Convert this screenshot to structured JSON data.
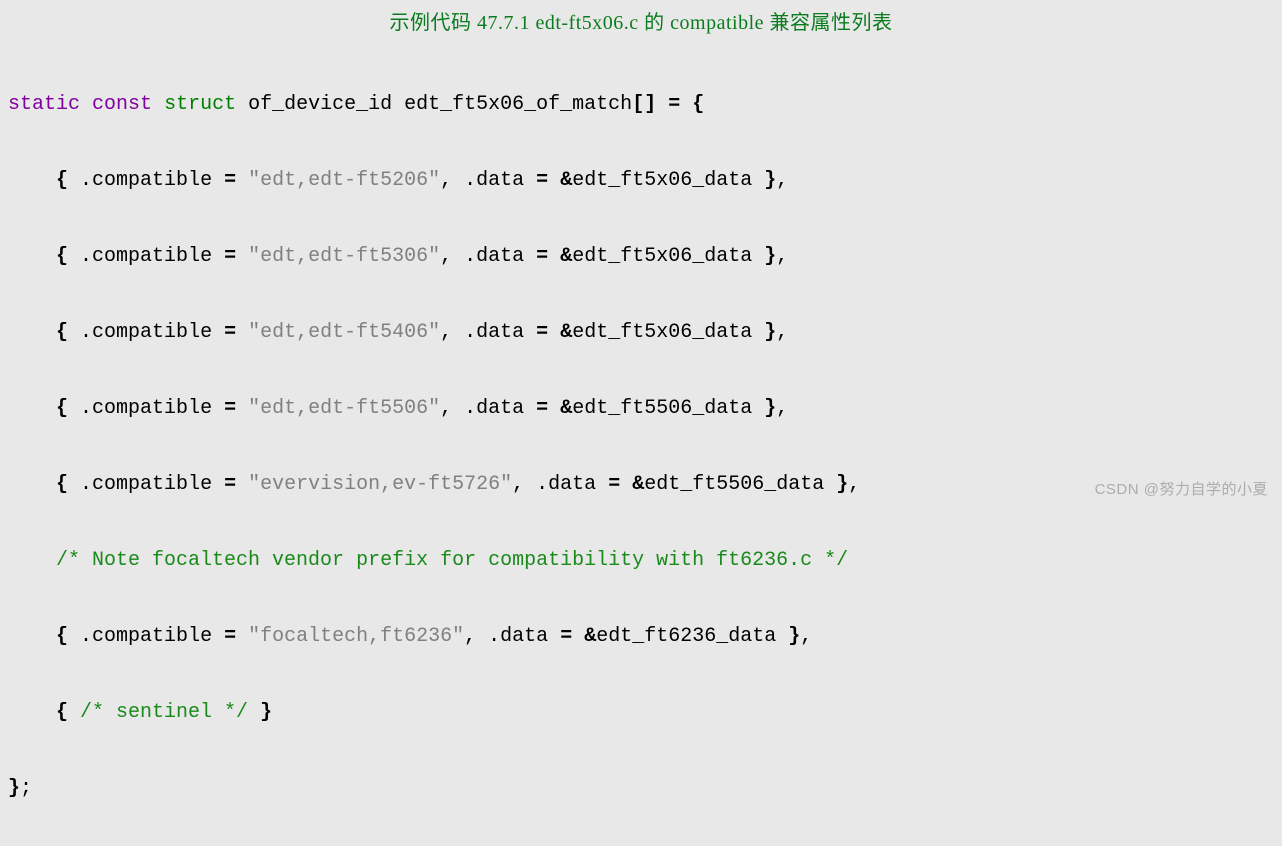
{
  "title": "示例代码 47.7.1 edt-ft5x06.c 的 compatible 兼容属性列表",
  "line1": {
    "kw1": "static",
    "kw2": "const",
    "kw3": "struct",
    "type": "of_device_id",
    "var": "edt_ft5x06_of_match",
    "brackets": "[]",
    "eq": " = ",
    "brace": "{"
  },
  "entries": [
    {
      "lb": "{ ",
      "dot1": ".",
      "field1": "compatible",
      "eq1": " = ",
      "str": "\"edt,edt-ft5206\"",
      "comma1": ", ",
      "dot2": ".",
      "field2": "data",
      "eq2": " = ",
      "amp": "&",
      "dataval": "edt_ft5x06_data",
      "rb": " }",
      "tc": ","
    },
    {
      "lb": "{ ",
      "dot1": ".",
      "field1": "compatible",
      "eq1": " = ",
      "str": "\"edt,edt-ft5306\"",
      "comma1": ", ",
      "dot2": ".",
      "field2": "data",
      "eq2": " = ",
      "amp": "&",
      "dataval": "edt_ft5x06_data",
      "rb": " }",
      "tc": ","
    },
    {
      "lb": "{ ",
      "dot1": ".",
      "field1": "compatible",
      "eq1": " = ",
      "str": "\"edt,edt-ft5406\"",
      "comma1": ", ",
      "dot2": ".",
      "field2": "data",
      "eq2": " = ",
      "amp": "&",
      "dataval": "edt_ft5x06_data",
      "rb": " }",
      "tc": ","
    },
    {
      "lb": "{ ",
      "dot1": ".",
      "field1": "compatible",
      "eq1": " = ",
      "str": "\"edt,edt-ft5506\"",
      "comma1": ", ",
      "dot2": ".",
      "field2": "data",
      "eq2": " = ",
      "amp": "&",
      "dataval": "edt_ft5506_data",
      "rb": " }",
      "tc": ","
    },
    {
      "lb": "{ ",
      "dot1": ".",
      "field1": "compatible",
      "eq1": " = ",
      "str": "\"evervision,ev-ft5726\"",
      "comma1": ", ",
      "dot2": ".",
      "field2": "data",
      "eq2": " = ",
      "amp": "&",
      "dataval": "edt_ft5506_data",
      "rb": " }",
      "tc": ","
    }
  ],
  "comment1": "/* Note focaltech vendor prefix for compatibility with ft6236.c */",
  "entry6": {
    "lb": "{ ",
    "dot1": ".",
    "field1": "compatible",
    "eq1": " = ",
    "str": "\"focaltech,ft6236\"",
    "comma1": ", ",
    "dot2": ".",
    "field2": "data",
    "eq2": " = ",
    "amp": "&",
    "dataval": "edt_ft6236_data",
    "rb": " }",
    "tc": ","
  },
  "sentinel": {
    "lb": "{ ",
    "comment": "/* sentinel */",
    "rb": " }"
  },
  "close": {
    "brace": "}",
    "semi": ";"
  },
  "indent": "    ",
  "watermark": "CSDN @努力自学的小夏"
}
